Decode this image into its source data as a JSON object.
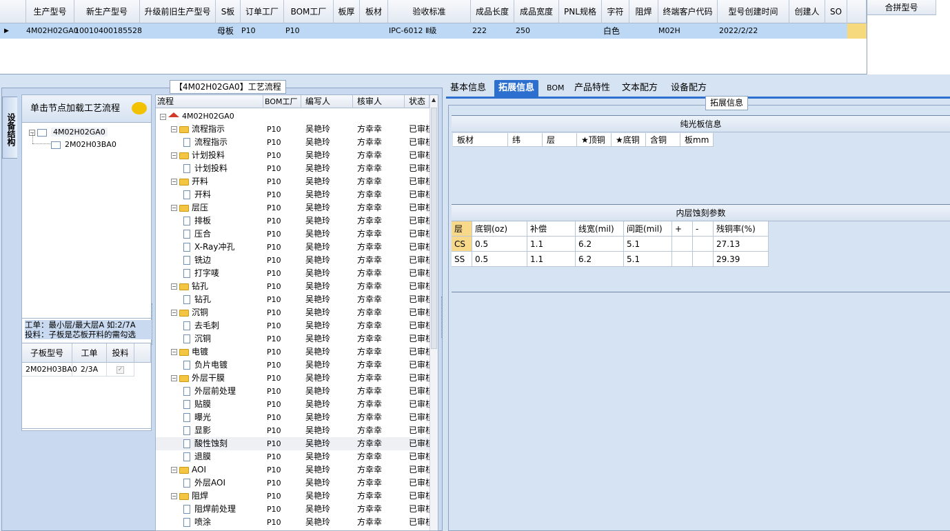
{
  "top_grid": {
    "columns": [
      "生产型号",
      "新生产型号",
      "升级前旧生产型号",
      "S板",
      "订单工厂",
      "BOM工厂",
      "板厚",
      "板材",
      "验收标准",
      "成品长度",
      "成品宽度",
      "PNL规格",
      "字符",
      "阻焊",
      "终端客户代码",
      "型号创建时间",
      "创建人",
      "SO"
    ],
    "row": {
      "prod_no": "4M02H02GA0",
      "new_prod_no": "10010400185528",
      "old_prod_no": "",
      "s_board": "母板",
      "order_factory": "P10",
      "bom_factory": "P10",
      "thickness": "",
      "material": "",
      "acceptance": "IPC-6012 Ⅱ级",
      "length": "222",
      "width": "250",
      "pnl": "",
      "char": "白色",
      "solder_mask": "",
      "customer_code": "M02H",
      "created": "2022/2/22",
      "creator": "",
      "so": ""
    },
    "merge_header": "合拼型号"
  },
  "left": {
    "vertical_tab": "设备结构",
    "process_title": "【4M02H02GA0】工艺流程",
    "load_button": "单击节点加载工艺流程",
    "tree": {
      "root": "4M02H02GA0",
      "child": "2M02H03BA0"
    },
    "note_line1": "工单：最小层/最大层A 如:2/7A",
    "note_line2": "投料：子板是芯板开料的需勾选",
    "sub_table": {
      "headers": [
        "子板型号",
        "工单",
        "投料"
      ],
      "row": {
        "model": "2M02H03BA0",
        "order": "2/3A",
        "feed_checked": "✓"
      }
    }
  },
  "process": {
    "headers": [
      "流程",
      "BOM工厂",
      "编写人",
      "核审人",
      "状态"
    ],
    "root": "4M02H02GA0",
    "rows": [
      {
        "name": "流程指示",
        "type": "folder",
        "bom": "P10",
        "writer": "吴艳玲",
        "reviewer": "方幸幸",
        "status": "已审核"
      },
      {
        "name": "流程指示",
        "type": "doc",
        "bom": "P10",
        "writer": "吴艳玲",
        "reviewer": "方幸幸",
        "status": "已审核"
      },
      {
        "name": "计划投料",
        "type": "folder",
        "bom": "P10",
        "writer": "吴艳玲",
        "reviewer": "方幸幸",
        "status": "已审核"
      },
      {
        "name": "计划投料",
        "type": "doc",
        "bom": "P10",
        "writer": "吴艳玲",
        "reviewer": "方幸幸",
        "status": "已审核"
      },
      {
        "name": "开料",
        "type": "folder",
        "bom": "P10",
        "writer": "吴艳玲",
        "reviewer": "方幸幸",
        "status": "已审核"
      },
      {
        "name": "开料",
        "type": "doc",
        "bom": "P10",
        "writer": "吴艳玲",
        "reviewer": "方幸幸",
        "status": "已审核"
      },
      {
        "name": "层压",
        "type": "folder",
        "bom": "P10",
        "writer": "吴艳玲",
        "reviewer": "方幸幸",
        "status": "已审核"
      },
      {
        "name": "排板",
        "type": "doc",
        "bom": "P10",
        "writer": "吴艳玲",
        "reviewer": "方幸幸",
        "status": "已审核"
      },
      {
        "name": "压合",
        "type": "doc",
        "bom": "P10",
        "writer": "吴艳玲",
        "reviewer": "方幸幸",
        "status": "已审核"
      },
      {
        "name": "X-Ray冲孔",
        "type": "doc",
        "bom": "P10",
        "writer": "吴艳玲",
        "reviewer": "方幸幸",
        "status": "已审核"
      },
      {
        "name": "铣边",
        "type": "doc",
        "bom": "P10",
        "writer": "吴艳玲",
        "reviewer": "方幸幸",
        "status": "已审核"
      },
      {
        "name": "打字唛",
        "type": "doc",
        "bom": "P10",
        "writer": "吴艳玲",
        "reviewer": "方幸幸",
        "status": "已审核"
      },
      {
        "name": "钻孔",
        "type": "folder",
        "bom": "P10",
        "writer": "吴艳玲",
        "reviewer": "方幸幸",
        "status": "已审核"
      },
      {
        "name": "钻孔",
        "type": "doc",
        "bom": "P10",
        "writer": "吴艳玲",
        "reviewer": "方幸幸",
        "status": "已审核"
      },
      {
        "name": "沉铜",
        "type": "folder",
        "bom": "P10",
        "writer": "吴艳玲",
        "reviewer": "方幸幸",
        "status": "已审核"
      },
      {
        "name": "去毛刺",
        "type": "doc",
        "bom": "P10",
        "writer": "吴艳玲",
        "reviewer": "方幸幸",
        "status": "已审核"
      },
      {
        "name": "沉铜",
        "type": "doc",
        "bom": "P10",
        "writer": "吴艳玲",
        "reviewer": "方幸幸",
        "status": "已审核"
      },
      {
        "name": "电镀",
        "type": "folder",
        "bom": "P10",
        "writer": "吴艳玲",
        "reviewer": "方幸幸",
        "status": "已审核"
      },
      {
        "name": "负片电镀",
        "type": "doc",
        "bom": "P10",
        "writer": "吴艳玲",
        "reviewer": "方幸幸",
        "status": "已审核"
      },
      {
        "name": "外层干膜",
        "type": "folder",
        "bom": "P10",
        "writer": "吴艳玲",
        "reviewer": "方幸幸",
        "status": "已审核"
      },
      {
        "name": "外层前处理",
        "type": "doc",
        "bom": "P10",
        "writer": "吴艳玲",
        "reviewer": "方幸幸",
        "status": "已审核"
      },
      {
        "name": "贴膜",
        "type": "doc",
        "bom": "P10",
        "writer": "吴艳玲",
        "reviewer": "方幸幸",
        "status": "已审核"
      },
      {
        "name": "曝光",
        "type": "doc",
        "bom": "P10",
        "writer": "吴艳玲",
        "reviewer": "方幸幸",
        "status": "已审核"
      },
      {
        "name": "显影",
        "type": "doc",
        "bom": "P10",
        "writer": "吴艳玲",
        "reviewer": "方幸幸",
        "status": "已审核"
      },
      {
        "name": "酸性蚀刻",
        "type": "doc",
        "bom": "P10",
        "writer": "吴艳玲",
        "reviewer": "方幸幸",
        "status": "已审核",
        "selected": true
      },
      {
        "name": "退膜",
        "type": "doc",
        "bom": "P10",
        "writer": "吴艳玲",
        "reviewer": "方幸幸",
        "status": "已审核"
      },
      {
        "name": "AOI",
        "type": "folder",
        "bom": "P10",
        "writer": "吴艳玲",
        "reviewer": "方幸幸",
        "status": "已审核"
      },
      {
        "name": "外层AOI",
        "type": "doc",
        "bom": "P10",
        "writer": "吴艳玲",
        "reviewer": "方幸幸",
        "status": "已审核"
      },
      {
        "name": "阻焊",
        "type": "folder",
        "bom": "P10",
        "writer": "吴艳玲",
        "reviewer": "方幸幸",
        "status": "已审核"
      },
      {
        "name": "阻焊前处理",
        "type": "doc",
        "bom": "P10",
        "writer": "吴艳玲",
        "reviewer": "方幸幸",
        "status": "已审核"
      },
      {
        "name": "喷涂",
        "type": "doc",
        "bom": "P10",
        "writer": "吴艳玲",
        "reviewer": "方幸幸",
        "status": "已审核"
      }
    ]
  },
  "right": {
    "tabs": [
      "基本信息",
      "拓展信息",
      "BOM",
      "产品特性",
      "文本配方",
      "设备配方"
    ],
    "active_tab": "拓展信息",
    "ext_title": "拓展信息",
    "pure_title": "纯光板信息",
    "pure_headers": [
      "板材",
      "纬",
      "层",
      "★顶铜",
      "★底铜",
      "含铜",
      "板mm"
    ],
    "inner_title": "内层蚀刻参数",
    "inner_headers": [
      "层",
      "底铜(oz)",
      "补偿",
      "线宽(mil)",
      "间距(mil)",
      "+",
      "-",
      "残铜率(%)"
    ],
    "inner_rows": [
      {
        "layer": "CS",
        "base": "0.5",
        "comp": "1.1",
        "width": "6.2",
        "space": "5.1",
        "plus": "",
        "minus": "",
        "ratio": "27.13"
      },
      {
        "layer": "SS",
        "base": "0.5",
        "comp": "1.1",
        "width": "6.2",
        "space": "5.1",
        "plus": "",
        "minus": "",
        "ratio": "29.39"
      }
    ]
  },
  "colors": {
    "accent": "#2c6fcf",
    "selected_row": "#bcd8f5",
    "background": "#d6e3f2"
  }
}
